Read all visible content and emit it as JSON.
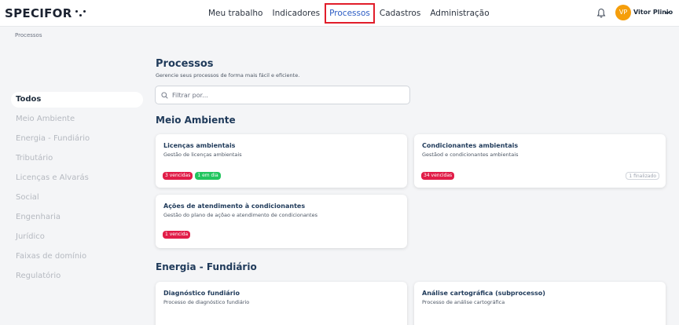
{
  "header": {
    "logo_text": "SPECIFOR",
    "nav": [
      "Meu trabalho",
      "Indicadores",
      "Processos",
      "Cadastros",
      "Administração"
    ],
    "active_nav": "Processos",
    "user": {
      "initials": "VP",
      "name": "Vitor Plinio"
    }
  },
  "breadcrumb": "Processos",
  "sidebar": {
    "items": [
      "Todos",
      "Meio Ambiente",
      "Energia - Fundiário",
      "Tributário",
      "Licenças e Alvarás",
      "Social",
      "Engenharia",
      "Jurídico",
      "Faixas de domínio",
      "Regulatório"
    ],
    "active": "Todos"
  },
  "page": {
    "title": "Processos",
    "subtitle": "Gerencie seus processos de forma mais fácil e eficiente.",
    "search_placeholder": "Filtrar por..."
  },
  "sections": [
    {
      "title": "Meio Ambiente",
      "cards": [
        {
          "title": "Licenças ambientais",
          "desc": "Gestão de licenças ambientais",
          "badges": [
            {
              "text": "3 vencidas",
              "tone": "red"
            },
            {
              "text": "1 em dia",
              "tone": "green"
            }
          ],
          "finalized": ""
        },
        {
          "title": "Condicionantes ambientais",
          "desc": "Gestãod e condicionantes ambientais",
          "badges": [
            {
              "text": "34 vencidas",
              "tone": "red"
            }
          ],
          "finalized": "1 finalizado"
        },
        {
          "title": "Ações de atendimento à condicionantes",
          "desc": "Gestão do plano de açõao e atendimento de condicionantes",
          "badges": [
            {
              "text": "1 vencida",
              "tone": "red"
            }
          ],
          "finalized": ""
        }
      ]
    },
    {
      "title": "Energia - Fundiário",
      "cards": [
        {
          "title": "Diagnóstico fundiário",
          "desc": "Processo de diagnóstico fundiário",
          "badges": [],
          "finalized": ""
        },
        {
          "title": "Análise cartográfica (subprocesso)",
          "desc": "Processo de análise cartográfica",
          "badges": [],
          "finalized": ""
        }
      ]
    }
  ],
  "colors": {
    "accent": "#2b5cc4",
    "title": "#1f3a5a",
    "danger": "#e11d48",
    "success": "#22c55e",
    "avatar": "#f59e0b",
    "highlight_border": "#e11d2a"
  }
}
